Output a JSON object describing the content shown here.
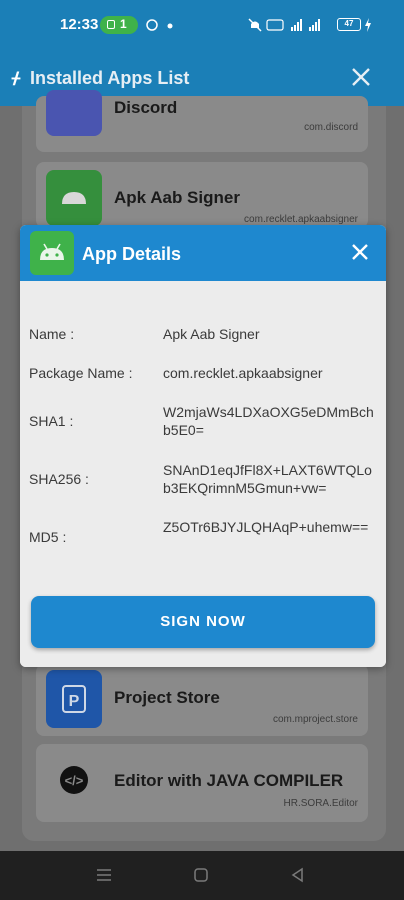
{
  "status_bar": {
    "time": "12:33",
    "call_count": "1",
    "battery": "47"
  },
  "header": {
    "title": "Installed Apps List"
  },
  "apps": [
    {
      "name": "Discord",
      "package": "com.discord",
      "icon": "discord-logo-icon",
      "color": "#5865f2"
    },
    {
      "name": "Apk Aab Signer",
      "package": "com.recklet.apkaabsigner",
      "icon": "android-robot-icon",
      "color": "#3fb24a"
    },
    {
      "name": "Project Store",
      "package": "com.mproject.store",
      "icon": "project-store-p-icon",
      "color": "#2f72d8"
    },
    {
      "name": "Editor with JAVA COMPILER",
      "package": "HR.SORA.Editor",
      "icon": "code-brackets-icon",
      "color": "#111111"
    }
  ],
  "dialog": {
    "title": "App Details",
    "fields": [
      {
        "label": "Name :",
        "value": "Apk Aab Signer"
      },
      {
        "label": "Package Name :",
        "value": "com.recklet.apkaabsigner"
      },
      {
        "label": "SHA1 :",
        "value": "W2mjaWs4LDXaOXG5eDMmBchb5E0="
      },
      {
        "label": "SHA256 :",
        "value": "SNAnD1eqJfFl8X+LAXT6WTQLob3EKQrimnM5Gmun+vw="
      },
      {
        "label": "MD5 :",
        "value": "Z5OTr6BJYJLQHAqP+uhemw=="
      }
    ],
    "button_label": "SIGN NOW"
  },
  "colors": {
    "primary": "#1e88cf",
    "header": "#1b7fb7",
    "android_green": "#3fb24a"
  }
}
